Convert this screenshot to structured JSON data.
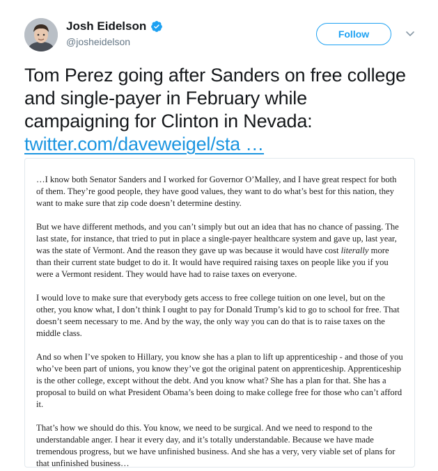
{
  "author": {
    "display_name": "Josh Eidelson",
    "handle": "@josheidelson",
    "verified": true
  },
  "actions": {
    "follow_label": "Follow",
    "more_icon": "chevron-down-icon"
  },
  "tweet": {
    "text": "Tom Perez going after Sanders on free college and single-payer in February while campaigning for Clinton in Nevada: ",
    "link_text": "twitter.com/daveweigel/sta …"
  },
  "transcript": {
    "p1": "…I know both Senator Sanders and I worked for Governor O’Malley, and I have great respect for both of them. They’re good people, they have good values, they want to do what’s best for this nation, they want to make sure that zip code doesn’t determine destiny.",
    "p2_a": "But we have different methods, and you can’t simply but out an idea that has no chance of passing. The last state, for instance, that tried to put in place a single-payer healthcare system and gave up, last year, was the state of Vermont. And the reason they gave up was because it would have cost ",
    "p2_em": "literally",
    "p2_b": " more than their current state budget to do it. It would have required raising taxes on people like you if you were a Vermont resident. They would have had to raise taxes on everyone.",
    "p3": "I would love to make sure that everybody gets access to free college tuition on one level, but on the other, you know what, I don’t think I ought to pay for Donald Trump’s kid to go to school for free. That doesn’t seem necessary to me. And by the way, the only way you can do that is to raise taxes on the middle class.",
    "p4": "And so when I’ve spoken to Hillary, you know she has a plan to lift up apprenticeship - and those of you who’ve been part of unions, you know they’ve got the original patent on apprenticeship. Apprenticeship is the other college, except without the debt. And you know what? She has a plan for that. She has a proposal to build on what President Obama’s been doing to make college free for those who can’t afford it.",
    "p5": "That’s how we should do this. You know, we need to be surgical. And we need to respond to the understandable anger. I hear it every day, and it’s totally understandable. Because we have made tremendous progress, but we have unfinished business. And she has a very, very viable set of plans for that unfinished business…"
  },
  "colors": {
    "link": "#1b95e0",
    "follow": "#1da1f2",
    "handle": "#657786",
    "text": "#14171a"
  }
}
